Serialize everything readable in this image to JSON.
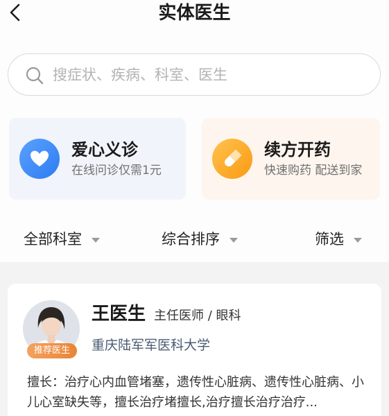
{
  "header": {
    "title": "实体医生"
  },
  "search": {
    "placeholder": "搜症状、疾病、科室、医生"
  },
  "services": [
    {
      "title": "爱心义诊",
      "subtitle": "在线问诊仅需1元",
      "icon": "heart-icon",
      "color": "#3d8bf7"
    },
    {
      "title": "续方开药",
      "subtitle": "快速购药 配送到家",
      "icon": "pill-icon",
      "color": "#fba524"
    }
  ],
  "filters": [
    {
      "label": "全部科室"
    },
    {
      "label": "综合排序"
    },
    {
      "label": "筛选"
    }
  ],
  "doctor": {
    "badge": "推荐医生",
    "name": "王医生",
    "title": "主任医师 / 眼科",
    "hospital": "重庆陆军军医科大学",
    "specialty": "擅长：治疗心内血管堵塞，遗传性心脏病、遗传性心脏病、小儿心室缺失等，擅长治疗堵擅长,治疗擅长治疗治疗..."
  }
}
